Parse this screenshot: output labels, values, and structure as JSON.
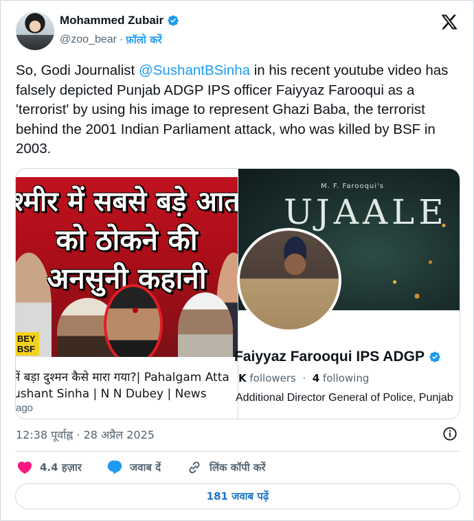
{
  "author": {
    "name": "Mohammed Zubair",
    "handle": "@zoo_bear",
    "separator": "·",
    "follow_label": "फ़ॉलो करें"
  },
  "tweet": {
    "text_pre": "So, Godi Journalist ",
    "mention": "@SushantBSinha",
    "text_post": " in his recent youtube video has falsely depicted Punjab ADGP IPS officer Faiyyaz Farooqui as a 'terrorist' by using his image to represent Ghazi Baba, the terrorist behind the 2001 Indian Parliament attack, who was killed by BSF in 2003."
  },
  "media": {
    "left": {
      "thumb_line1": "श्मीर में सबसे बड़े आत",
      "thumb_line2": "को ठोकने की",
      "thumb_line3": "अनसुनी कहानी",
      "badge": "BEY BSF",
      "title_line1": "में बड़ा दुश्मन कैसे मारा गया?| Pahalgam Atta",
      "title_line2": "ushant Sinha | N N Dubey | News",
      "ago": "ago"
    },
    "right": {
      "banner_subtitle": "M. F. Farooqui's",
      "banner_title": "UJAALE",
      "profile_name": "Faiyyaz Farooqui IPS ADGP",
      "followers_prefix": "K",
      "followers_label": "followers",
      "following_count": "4",
      "following_label": "following",
      "description": "Additional Director General of Police, Punjab"
    }
  },
  "meta": {
    "timestamp": "12:38 पूर्वाह्न · 28 अप्रैल 2025"
  },
  "actions": {
    "likes": "4.4 हज़ार",
    "reply": "जवाब दें",
    "copy_link": "लिंक कॉपी करें"
  },
  "read_replies": "181 जवाब पढ़ें",
  "colors": {
    "accent": "#1d9bf0",
    "like": "#f91880",
    "text": "#0f1419",
    "muted": "#536471",
    "thumb_red": "#c1121f"
  },
  "icons": {
    "verified": "verified-badge-icon",
    "x_logo": "x-logo-icon",
    "info": "info-icon",
    "like": "heart-icon",
    "reply": "speech-bubble-icon",
    "copy": "link-icon"
  }
}
